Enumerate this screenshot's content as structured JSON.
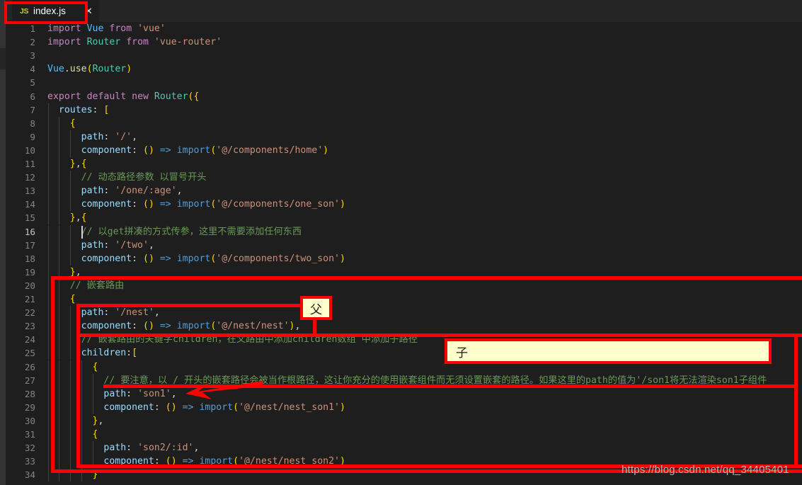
{
  "window": {
    "background_color": "#1e1e1e",
    "tabbar_color": "#252526"
  },
  "tab": {
    "icon_label": "JS",
    "icon_name": "javascript-file-icon",
    "filename": "index.js",
    "close_label": "✕"
  },
  "editor": {
    "language": "javascript",
    "first_visible_line": 1,
    "last_visible_line": 34,
    "active_line": 16,
    "lines": [
      {
        "n": "1",
        "text": "import Vue from 'vue'"
      },
      {
        "n": "2",
        "text": "import Router from 'vue-router'"
      },
      {
        "n": "3",
        "text": ""
      },
      {
        "n": "4",
        "text": "Vue.use(Router)"
      },
      {
        "n": "5",
        "text": ""
      },
      {
        "n": "6",
        "text": "export default new Router({"
      },
      {
        "n": "7",
        "text": "  routes: ["
      },
      {
        "n": "8",
        "text": "    {"
      },
      {
        "n": "9",
        "text": "      path: '/',"
      },
      {
        "n": "10",
        "text": "      component: () => import('@/components/home')"
      },
      {
        "n": "11",
        "text": "    },{"
      },
      {
        "n": "12",
        "text": "      // 动态路径参数 以冒号开头"
      },
      {
        "n": "13",
        "text": "      path: '/one/:age',"
      },
      {
        "n": "14",
        "text": "      component: () => import('@/components/one_son')"
      },
      {
        "n": "15",
        "text": "    },{"
      },
      {
        "n": "16",
        "text": "      // 以get拼凑的方式传参，这里不需要添加任何东西"
      },
      {
        "n": "17",
        "text": "      path: '/two',"
      },
      {
        "n": "18",
        "text": "      component: () => import('@/components/two_son')"
      },
      {
        "n": "19",
        "text": "    },"
      },
      {
        "n": "20",
        "text": "    // 嵌套路由"
      },
      {
        "n": "21",
        "text": "    {"
      },
      {
        "n": "22",
        "text": "      path: '/nest',"
      },
      {
        "n": "23",
        "text": "      component: () => import('@/nest/nest'),"
      },
      {
        "n": "24",
        "text": "      // 嵌套路由的关键字children，在父路由中添加children数组 中添加子路径"
      },
      {
        "n": "25",
        "text": "      children:["
      },
      {
        "n": "26",
        "text": "        {"
      },
      {
        "n": "27",
        "text": "          // 要注意，以 / 开头的嵌套路径会被当作根路径，这让你充分的使用嵌套组件而无须设置嵌套的路径。如果这里的path的值为'/son1将无法渲染son1子组件"
      },
      {
        "n": "28",
        "text": "          path: 'son1',"
      },
      {
        "n": "29",
        "text": "          component: () => import('@/nest/nest_son1')"
      },
      {
        "n": "30",
        "text": "        },"
      },
      {
        "n": "31",
        "text": "        {"
      },
      {
        "n": "32",
        "text": "          path: 'son2/:id',"
      },
      {
        "n": "33",
        "text": "          component: () => import('@/nest/nest_son2')"
      },
      {
        "n": "34",
        "text": "        }"
      }
    ]
  },
  "annotations": {
    "accent_color": "#fe0000",
    "note_background": "#ffffcc",
    "parent_label": "父",
    "child_label": "子",
    "boxes": [
      {
        "name": "tab-highlight-box"
      },
      {
        "name": "nested-route-outer-box"
      },
      {
        "name": "parent-route-box"
      },
      {
        "name": "children-routes-box"
      }
    ],
    "arrow": {
      "name": "son1-path-arrow",
      "points_to": "path: 'son1',"
    },
    "underline": {
      "name": "comment-underline-line-27"
    }
  },
  "watermark": {
    "text": "https://blog.csdn.net/qq_34405401"
  }
}
